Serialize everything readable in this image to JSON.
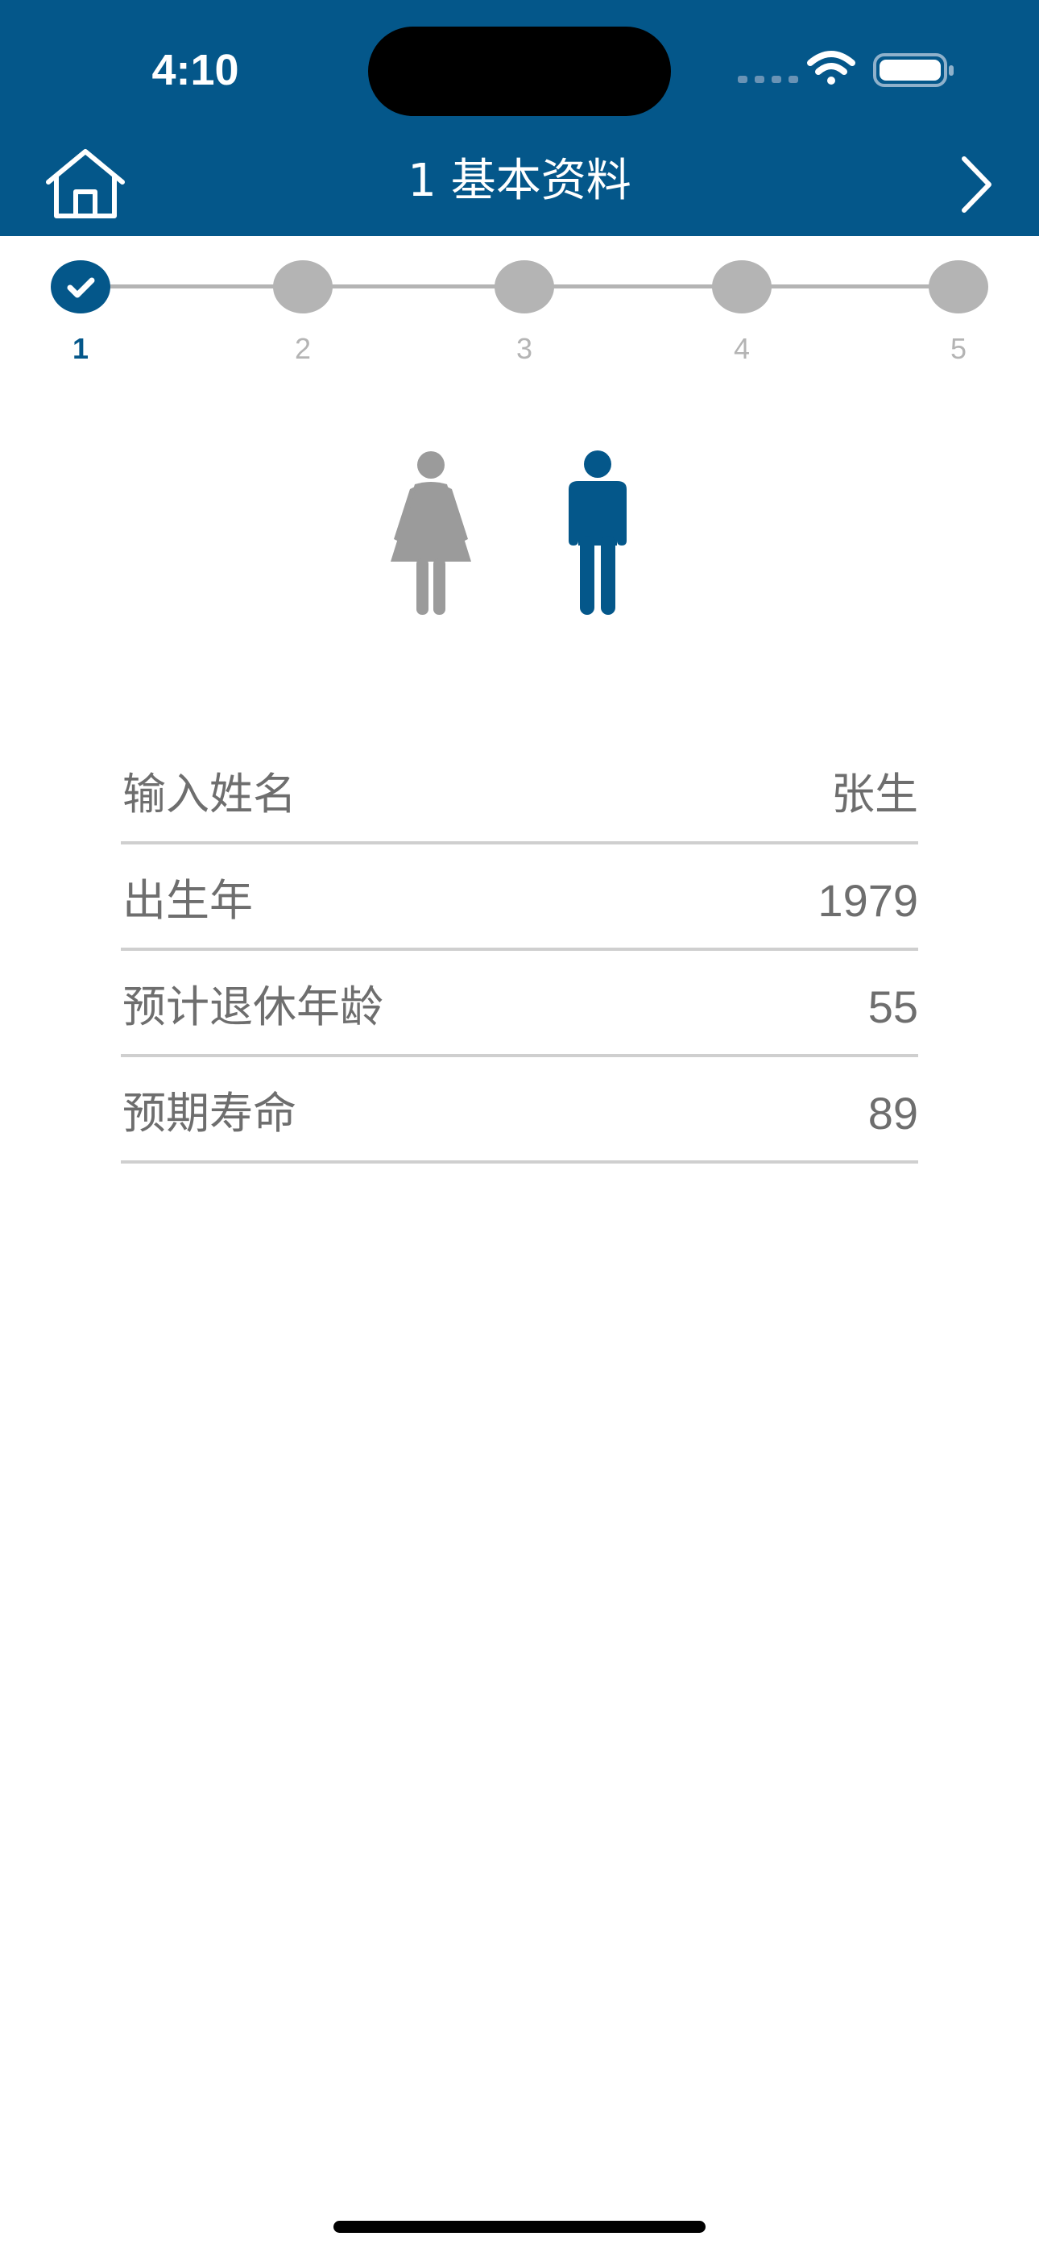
{
  "status_bar": {
    "time": "4:10"
  },
  "header": {
    "title": "1 基本资料",
    "home_icon": "home-icon",
    "next_icon": "chevron-right-icon",
    "background_color": "#04578A"
  },
  "stepper": {
    "current_step": 1,
    "steps": [
      {
        "label": "1",
        "state": "completed"
      },
      {
        "label": "2",
        "state": "pending"
      },
      {
        "label": "3",
        "state": "pending"
      },
      {
        "label": "4",
        "state": "pending"
      },
      {
        "label": "5",
        "state": "pending"
      }
    ],
    "active_color": "#04578A",
    "inactive_color": "#B4B4B4"
  },
  "gender": {
    "options": [
      {
        "name": "female",
        "icon": "female-icon",
        "selected": false
      },
      {
        "name": "male",
        "icon": "male-icon",
        "selected": true
      }
    ],
    "selected_color": "#04578A",
    "unselected_color": "#9B9B9B"
  },
  "form": {
    "rows": [
      {
        "label": "输入姓名",
        "value": "张生"
      },
      {
        "label": "出生年",
        "value": "1979"
      },
      {
        "label": "预计退休年龄",
        "value": "55"
      },
      {
        "label": "预期寿命",
        "value": "89"
      }
    ]
  }
}
